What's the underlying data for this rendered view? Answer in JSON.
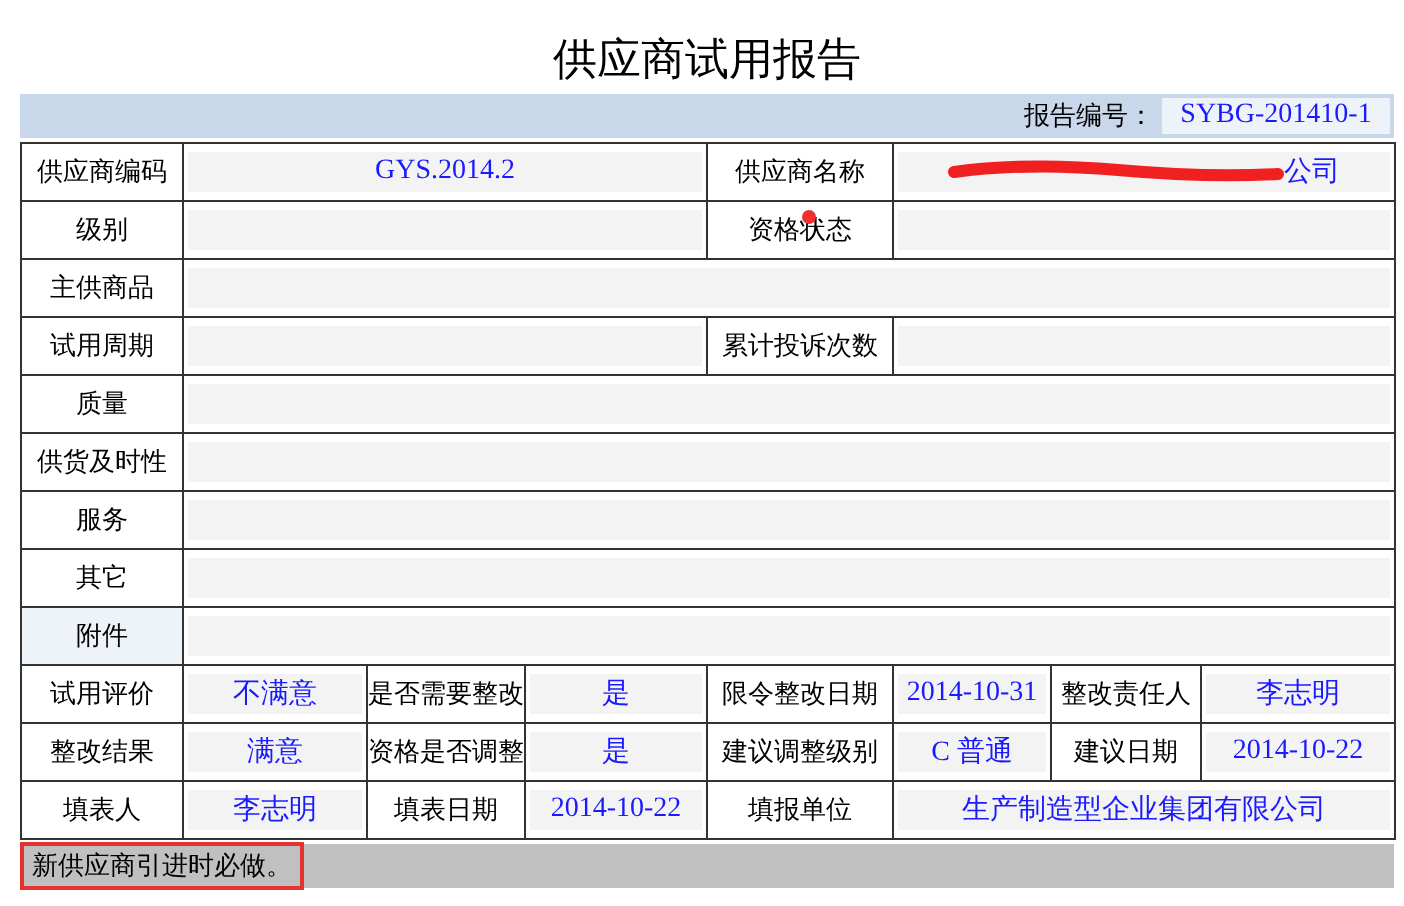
{
  "title": "供应商试用报告",
  "report_no": {
    "label": "报告编号：",
    "value": "SYBG-201410-1"
  },
  "rows": [
    {
      "kind": "pair",
      "shaded": false,
      "cells": [
        {
          "kind": "label",
          "text": "供应商编码"
        },
        {
          "kind": "value",
          "text": "GYS.2014.2"
        },
        {
          "kind": "label",
          "text": "供应商名称"
        },
        {
          "kind": "value",
          "text": "公司",
          "redacted": true
        }
      ]
    },
    {
      "kind": "pair",
      "shaded": false,
      "cells": [
        {
          "kind": "label",
          "text": "级别"
        },
        {
          "kind": "value"
        },
        {
          "kind": "label",
          "text": "资格状态"
        },
        {
          "kind": "value"
        }
      ]
    },
    {
      "kind": "wide",
      "shaded": false,
      "cells": [
        {
          "kind": "label",
          "text": "主供商品"
        },
        {
          "kind": "value"
        }
      ]
    },
    {
      "kind": "pair",
      "shaded": false,
      "cells": [
        {
          "kind": "label",
          "text": "试用周期"
        },
        {
          "kind": "value"
        },
        {
          "kind": "label",
          "text": "累计投诉次数"
        },
        {
          "kind": "value"
        }
      ]
    },
    {
      "kind": "wide",
      "shaded": false,
      "cells": [
        {
          "kind": "label",
          "text": "质量"
        },
        {
          "kind": "value"
        }
      ]
    },
    {
      "kind": "wide",
      "shaded": false,
      "cells": [
        {
          "kind": "label",
          "text": "供货及时性"
        },
        {
          "kind": "value"
        }
      ]
    },
    {
      "kind": "wide",
      "shaded": false,
      "cells": [
        {
          "kind": "label",
          "text": "服务"
        },
        {
          "kind": "value"
        }
      ]
    },
    {
      "kind": "wide",
      "shaded": false,
      "cells": [
        {
          "kind": "label",
          "text": "其它"
        },
        {
          "kind": "value"
        }
      ]
    },
    {
      "kind": "wide",
      "shaded": true,
      "cells": [
        {
          "kind": "label",
          "text": "附件"
        },
        {
          "kind": "value"
        }
      ]
    },
    {
      "kind": "grid",
      "shaded": false,
      "cells": [
        {
          "kind": "label",
          "text": "试用评价"
        },
        {
          "kind": "value",
          "text": "不满意"
        },
        {
          "kind": "label",
          "text": "是否需要整改"
        },
        {
          "kind": "value",
          "text": "是"
        },
        {
          "kind": "label",
          "text": "限令整改日期"
        },
        {
          "kind": "value",
          "text": "2014-10-31"
        },
        {
          "kind": "label",
          "text": "整改责任人"
        },
        {
          "kind": "value",
          "text": "李志明"
        }
      ]
    },
    {
      "kind": "grid",
      "shaded": false,
      "cells": [
        {
          "kind": "label",
          "text": "整改结果"
        },
        {
          "kind": "value",
          "text": "满意"
        },
        {
          "kind": "label",
          "text": "资格是否调整"
        },
        {
          "kind": "value",
          "text": "是"
        },
        {
          "kind": "label",
          "text": "建议调整级别"
        },
        {
          "kind": "value",
          "text": "C 普通"
        },
        {
          "kind": "label",
          "text": "建议日期"
        },
        {
          "kind": "value",
          "text": "2014-10-22"
        }
      ]
    },
    {
      "kind": "last",
      "shaded": false,
      "cells": [
        {
          "kind": "label",
          "text": "填表人"
        },
        {
          "kind": "value",
          "text": "李志明"
        },
        {
          "kind": "label",
          "text": "填表日期"
        },
        {
          "kind": "value",
          "text": "2014-10-22"
        },
        {
          "kind": "label",
          "text": "填报单位"
        },
        {
          "kind": "value",
          "text": "生产制造型企业集团有限公司"
        }
      ]
    }
  ],
  "footer": {
    "text": "新供应商引进时必做。",
    "highlighted": true
  }
}
